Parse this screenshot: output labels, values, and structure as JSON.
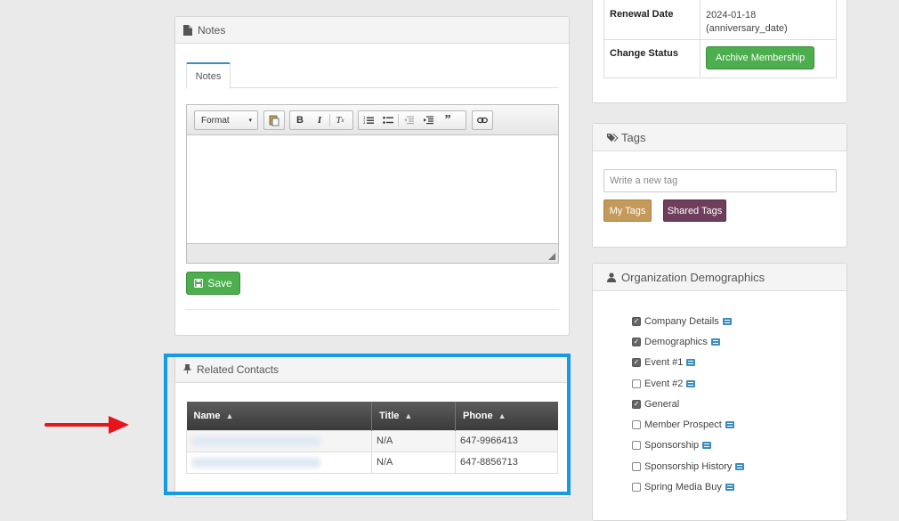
{
  "notes": {
    "panel_title": "Notes",
    "tab_label": "Notes",
    "format_label": "Format",
    "save_label": "Save"
  },
  "contacts": {
    "panel_title": "Related Contacts",
    "columns": [
      "Name",
      "Title",
      "Phone"
    ],
    "rows": [
      {
        "name": "",
        "title": "N/A",
        "phone": "647-9966413"
      },
      {
        "name": "",
        "title": "N/A",
        "phone": "647-8856713"
      }
    ]
  },
  "membership": {
    "renewal_label": "Renewal Date",
    "renewal_value_line1": "2024-01-18",
    "renewal_value_line2": "(anniversary_date)",
    "status_label": "Change Status",
    "archive_label": "Archive Membership"
  },
  "tags": {
    "panel_title": "Tags",
    "input_placeholder": "Write a new tag",
    "my_tags_label": "My Tags",
    "shared_tags_label": "Shared Tags"
  },
  "demographics": {
    "panel_title": "Organization Demographics",
    "items": [
      {
        "label": "Company Details",
        "checked": true,
        "has_icon": true
      },
      {
        "label": "Demographics",
        "checked": true,
        "has_icon": true
      },
      {
        "label": "Event #1",
        "checked": true,
        "has_icon": true
      },
      {
        "label": "Event #2",
        "checked": false,
        "has_icon": true
      },
      {
        "label": "General",
        "checked": true,
        "has_icon": false
      },
      {
        "label": "Member Prospect",
        "checked": false,
        "has_icon": true
      },
      {
        "label": "Sponsorship",
        "checked": false,
        "has_icon": true
      },
      {
        "label": "Sponsorship History",
        "checked": false,
        "has_icon": true
      },
      {
        "label": "Spring Media Buy",
        "checked": false,
        "has_icon": true
      }
    ]
  },
  "colors": {
    "highlight_border": "#159ae8",
    "arrow": "#e8141b",
    "success": "#4cae4c",
    "my_tags": "#c49a5a",
    "shared_tags": "#6e3e5c"
  }
}
